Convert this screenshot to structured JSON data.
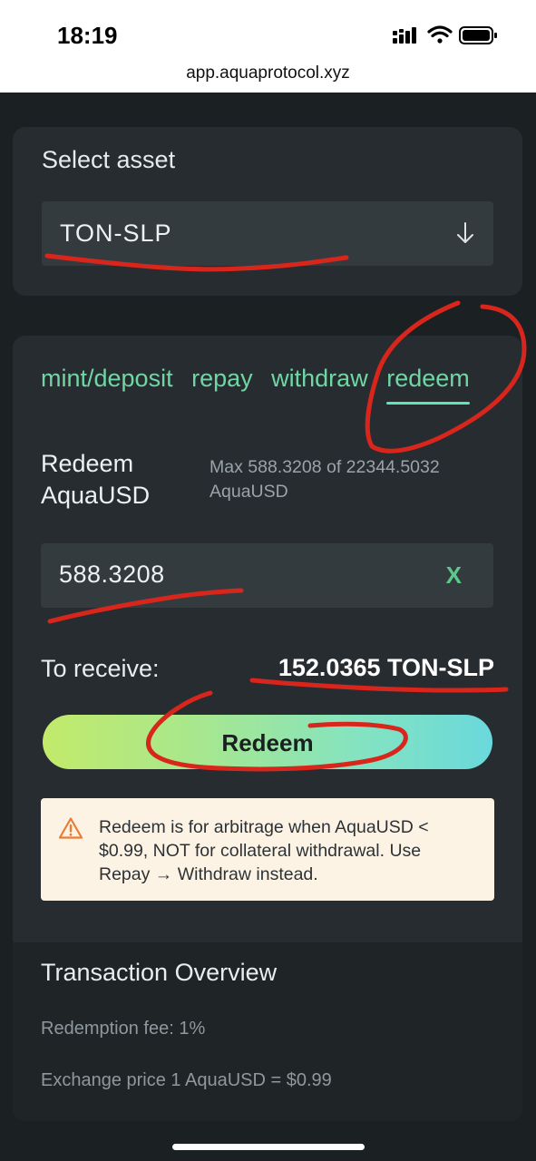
{
  "status_bar": {
    "time": "18:19",
    "url": "app.aquaprotocol.xyz",
    "icons": [
      "signal-icon",
      "wifi-icon",
      "battery-icon"
    ]
  },
  "asset_card": {
    "label": "Select asset",
    "selected_asset": "TON-SLP",
    "dropdown_icon": "arrow-down-icon"
  },
  "tabs": [
    {
      "label": "mint/deposit",
      "active": false
    },
    {
      "label": "repay",
      "active": false
    },
    {
      "label": "withdraw",
      "active": false
    },
    {
      "label": "redeem",
      "active": true
    }
  ],
  "redeem": {
    "title": "Redeem AquaUSD",
    "max_info": "Max 588.3208 of 22344.5032 AquaUSD",
    "amount_value": "588.3208",
    "clear_label": "X",
    "receive_label": "To receive:",
    "receive_value": "152.0365 TON-SLP",
    "button_label": "Redeem"
  },
  "warning": {
    "icon": "warning-triangle-icon",
    "text": "Redeem is for arbitrage when AquaUSD < $0.99, NOT for collateral withdrawal. Use Repay → Withdraw instead."
  },
  "overview": {
    "title": "Transaction Overview",
    "fee": "Redemption fee: 1%",
    "price": "Exchange price 1 AquaUSD = $0.99"
  },
  "colors": {
    "background": "#1b2023",
    "card": "#262c30",
    "input": "#343b3f",
    "accent_green": "#6fd6a4",
    "annotation_red": "#d9261c",
    "warning_bg": "#fdf3e4"
  }
}
